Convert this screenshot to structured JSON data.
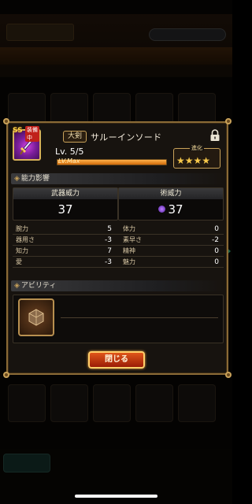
{
  "weapon": {
    "rarity": "SS",
    "equipped_badge": "装備中",
    "type": "大剣",
    "name": "サルーインソード",
    "level": "Lv. 5/5",
    "level_fill": 1.0,
    "max_label": "LV.Max",
    "evolution_label": "進化",
    "stars": "★★★★",
    "star_count": 4
  },
  "power_section": {
    "title": "能力影響",
    "weapon_power_label": "武器威力",
    "weapon_power_value": "37",
    "magic_power_label": "術威力",
    "magic_power_value": "37"
  },
  "stats": {
    "left": [
      {
        "name": "腕力",
        "value": "5"
      },
      {
        "name": "器用さ",
        "value": "-3"
      },
      {
        "name": "知力",
        "value": "7"
      },
      {
        "name": "愛",
        "value": "-3"
      }
    ],
    "right": [
      {
        "name": "体力",
        "value": "0"
      },
      {
        "name": "素早さ",
        "value": "-2"
      },
      {
        "name": "精神",
        "value": "0"
      },
      {
        "name": "魅力",
        "value": "0"
      }
    ]
  },
  "ability_section": {
    "title": "アビリティ"
  },
  "buttons": {
    "close": "閉じる"
  },
  "colors": {
    "accent_gold": "#c9a25a",
    "close_button": "#e0561a",
    "star": "#f7c84a"
  }
}
